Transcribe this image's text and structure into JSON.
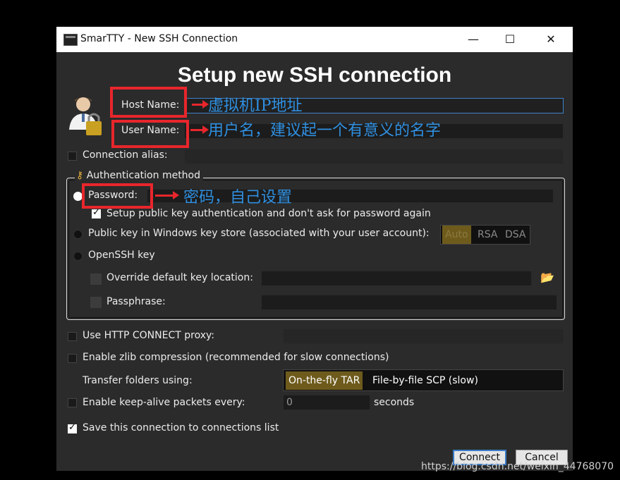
{
  "window": {
    "title": "SmarTTY - New SSH Connection",
    "minimize": "—",
    "maximize": "☐",
    "close": "✕"
  },
  "heading": "Setup new SSH connection",
  "host": {
    "label": "Host Name:",
    "value": ""
  },
  "user": {
    "label": "User Name:",
    "value": ""
  },
  "alias": {
    "label": "Connection alias:",
    "checked": false,
    "value": ""
  },
  "auth": {
    "group_title": "Authentication method",
    "password": {
      "label": "Password:",
      "selected": true,
      "value": ""
    },
    "setup_pubkey": {
      "label": "Setup public key authentication and don't ask for password again",
      "checked": true
    },
    "winkey": {
      "label": "Public key in Windows key store (associated with your user account):",
      "selected": false,
      "options": [
        "Auto",
        "RSA",
        "DSA"
      ],
      "selected_option": "Auto"
    },
    "openssh": {
      "label": "OpenSSH key",
      "selected": false
    },
    "override": {
      "label": "Override default key location:",
      "checked": false,
      "value": ""
    },
    "passphrase": {
      "label": "Passphrase:",
      "checked": false,
      "value": ""
    }
  },
  "proxy": {
    "label": "Use HTTP CONNECT proxy:",
    "checked": false,
    "value": ""
  },
  "zlib": {
    "label": "Enable zlib compression (recommended for slow connections)",
    "checked": false
  },
  "transfer": {
    "label": "Transfer folders using:",
    "options": [
      "On-the-fly TAR",
      "File-by-file SCP (slow)"
    ],
    "selected": "On-the-fly TAR"
  },
  "keepalive": {
    "label": "Enable keep-alive packets every:",
    "checked": false,
    "value": "0",
    "unit": "seconds"
  },
  "save": {
    "label": "Save this connection to connections list",
    "checked": true
  },
  "buttons": {
    "connect": "Connect",
    "cancel": "Cancel"
  },
  "annotations": {
    "host": "虚拟机IP地址",
    "user": "用户名，建议起一个有意义的名字",
    "password": "密码，自己设置"
  },
  "watermark": "https://blog.csdn.net/weixin_44768070",
  "colors": {
    "accent_selected": "#6e5b1c",
    "annotation_red": "#e8262c",
    "annotation_blue": "#2f8fe0",
    "focus_blue": "#3e82c8"
  }
}
